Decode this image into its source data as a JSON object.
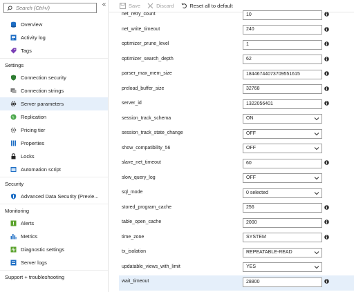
{
  "sidebar": {
    "search_placeholder": "Search (Ctrl+/)",
    "collapse_label": "«",
    "items_top": [
      {
        "label": "Overview",
        "icon": "database-icon"
      },
      {
        "label": "Activity log",
        "icon": "activity-log-icon"
      },
      {
        "label": "Tags",
        "icon": "tag-icon"
      }
    ],
    "section_settings": "Settings",
    "items_settings": [
      {
        "label": "Connection security",
        "icon": "shield-icon"
      },
      {
        "label": "Connection strings",
        "icon": "connection-icon"
      },
      {
        "label": "Server parameters",
        "icon": "gear-icon",
        "active": true
      },
      {
        "label": "Replication",
        "icon": "globe-icon"
      },
      {
        "label": "Pricing tier",
        "icon": "pricing-gear-icon"
      },
      {
        "label": "Properties",
        "icon": "properties-icon"
      },
      {
        "label": "Locks",
        "icon": "lock-icon"
      },
      {
        "label": "Automation script",
        "icon": "script-icon"
      }
    ],
    "section_security": "Security",
    "items_security": [
      {
        "label": "Advanced Data Security (Previe...",
        "icon": "security-shield-icon"
      }
    ],
    "section_monitoring": "Monitoring",
    "items_monitoring": [
      {
        "label": "Alerts",
        "icon": "alert-icon"
      },
      {
        "label": "Metrics",
        "icon": "metrics-icon"
      },
      {
        "label": "Diagnostic settings",
        "icon": "diagnostic-icon"
      },
      {
        "label": "Server logs",
        "icon": "server-logs-icon"
      }
    ],
    "section_support": "Support + troubleshooting"
  },
  "toolbar": {
    "save_label": "Save",
    "discard_label": "Discard",
    "reset_label": "Reset all to default"
  },
  "colors": {
    "active_bg": "#e5effa",
    "accent": "#0078d4"
  },
  "params": [
    {
      "name": "net_retry_count",
      "value": "10",
      "type": "text"
    },
    {
      "name": "net_write_timeout",
      "value": "240",
      "type": "text"
    },
    {
      "name": "optimizer_prune_level",
      "value": "1",
      "type": "text"
    },
    {
      "name": "optimizer_search_depth",
      "value": "62",
      "type": "text"
    },
    {
      "name": "parser_max_mem_size",
      "value": "18446744073709551615",
      "type": "text"
    },
    {
      "name": "preload_buffer_size",
      "value": "32768",
      "type": "text"
    },
    {
      "name": "server_id",
      "value": "1322056401",
      "type": "text"
    },
    {
      "name": "session_track_schema",
      "value": "ON",
      "type": "select"
    },
    {
      "name": "session_track_state_change",
      "value": "OFF",
      "type": "select"
    },
    {
      "name": "show_compatibility_56",
      "value": "OFF",
      "type": "select"
    },
    {
      "name": "slave_net_timeout",
      "value": "60",
      "type": "text"
    },
    {
      "name": "slow_query_log",
      "value": "OFF",
      "type": "select"
    },
    {
      "name": "sql_mode",
      "value": "0 selected",
      "type": "select"
    },
    {
      "name": "stored_program_cache",
      "value": "256",
      "type": "text"
    },
    {
      "name": "table_open_cache",
      "value": "2000",
      "type": "text"
    },
    {
      "name": "time_zone",
      "value": "SYSTEM",
      "type": "text"
    },
    {
      "name": "tx_isolation",
      "value": "REPEATABLE-READ",
      "type": "select"
    },
    {
      "name": "updatable_views_with_limit",
      "value": "YES",
      "type": "select"
    },
    {
      "name": "wait_timeout",
      "value": "28800",
      "type": "text",
      "active": true
    }
  ]
}
